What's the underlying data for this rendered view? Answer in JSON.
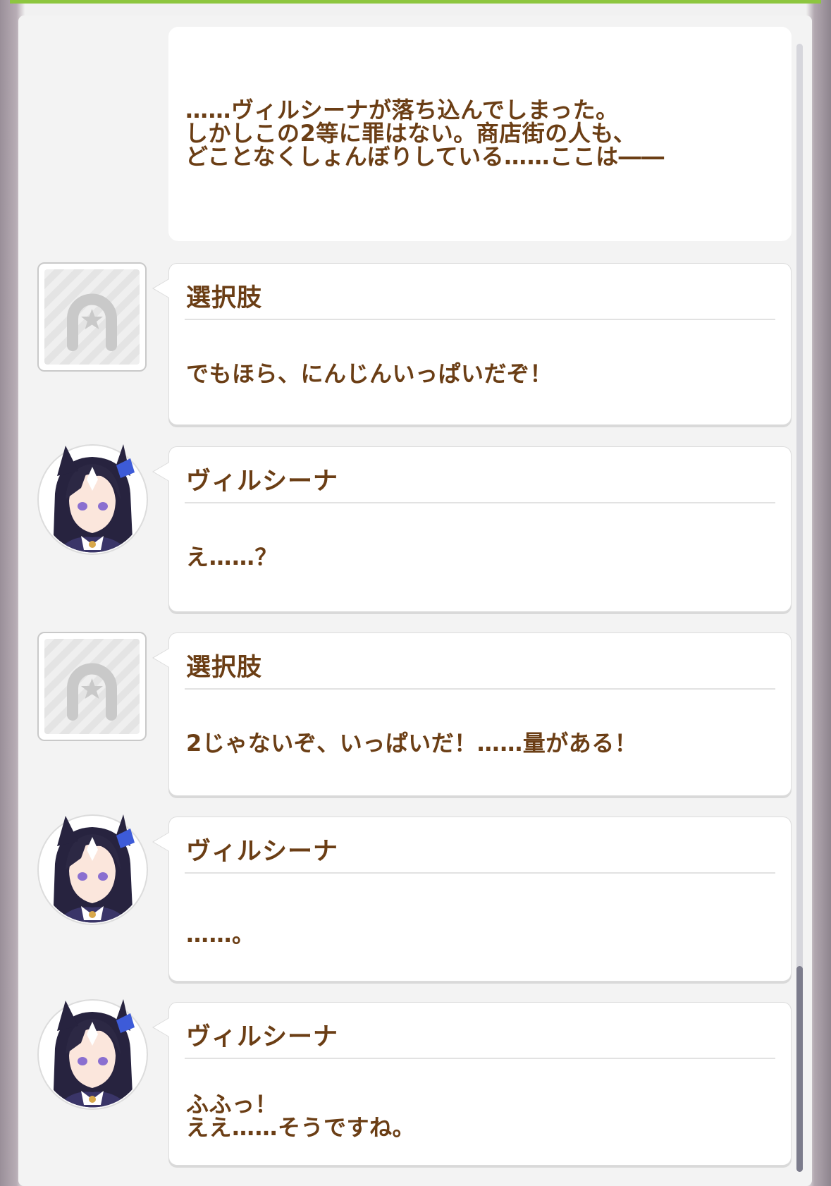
{
  "window": {
    "accent_color": "#8dc63f",
    "text_color": "#6b3e15"
  },
  "log": [
    {
      "type": "narration",
      "speaker": "",
      "text": "……ヴィルシーナが落ち込んでしまった。\nしかしこの2等に罪はない。商店街の人も、\nどことなくしょんぼりしている……ここは――"
    },
    {
      "type": "choice",
      "speaker": "選択肢",
      "text": "でもほら、にんじんいっぱいだぞ！",
      "icon": "horseshoe-icon"
    },
    {
      "type": "dialogue",
      "speaker": "ヴィルシーナ",
      "text": "え……？",
      "icon": "character-portrait"
    },
    {
      "type": "choice",
      "speaker": "選択肢",
      "text": "2じゃないぞ、いっぱいだ！……量がある！",
      "icon": "horseshoe-icon"
    },
    {
      "type": "dialogue",
      "speaker": "ヴィルシーナ",
      "text": "……。",
      "icon": "character-portrait"
    },
    {
      "type": "dialogue",
      "speaker": "ヴィルシーナ",
      "text": "ふふっ！\nええ……そうですね。",
      "icon": "character-portrait"
    }
  ]
}
